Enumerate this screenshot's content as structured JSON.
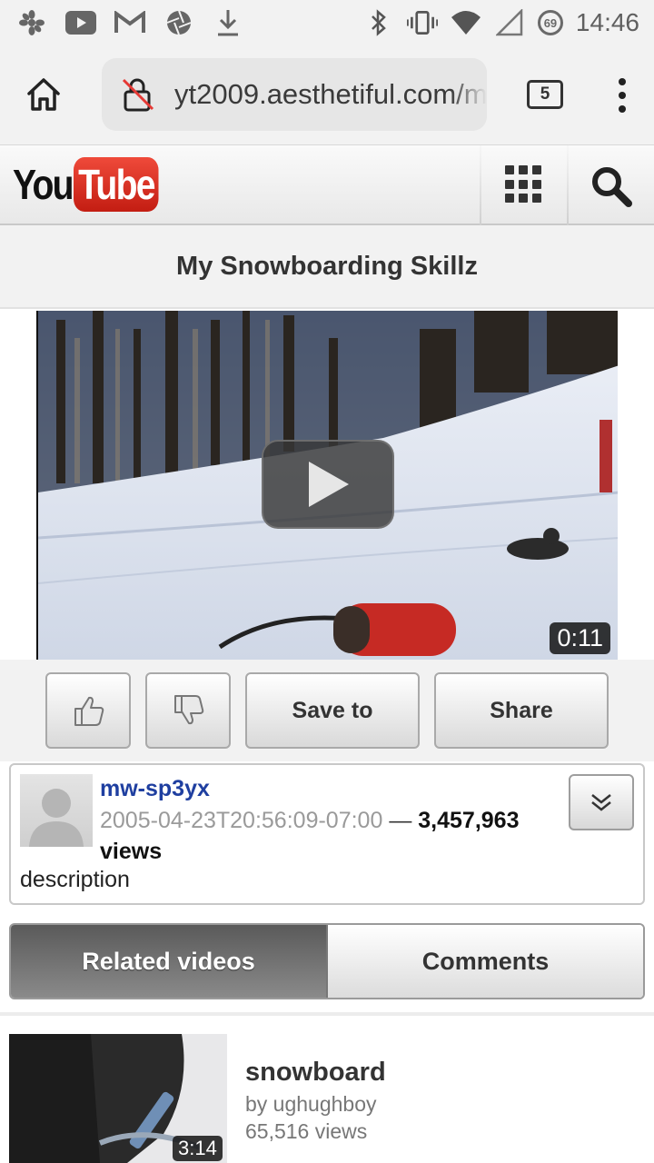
{
  "status_bar": {
    "left_icons": [
      "settings-flower-icon",
      "youtube-icon",
      "gmail-icon",
      "aperture-icon",
      "download-icon"
    ],
    "right_icons": [
      "bluetooth-icon",
      "vibrate-icon",
      "wifi-icon",
      "signal-icon"
    ],
    "battery_level": "69",
    "time": "14:46"
  },
  "browser": {
    "url": "yt2009.aesthetiful.com/m",
    "tab_count": "5"
  },
  "header": {
    "logo_you": "You",
    "logo_tube": "Tube"
  },
  "video": {
    "title": "My Snowboarding Skillz",
    "duration": "0:11"
  },
  "actions": {
    "save_label": "Save to",
    "share_label": "Share"
  },
  "info": {
    "author": "mw-sp3yx",
    "date": "2005-04-23T20:56:09-07:00",
    "separator": "—",
    "views": "3,457,963 views",
    "description": "description"
  },
  "tabs": {
    "related": "Related videos",
    "comments": "Comments"
  },
  "related": [
    {
      "title": "snowboard",
      "by": "by ughughboy",
      "views": "65,516 views",
      "duration": "3:14"
    }
  ],
  "colors": {
    "youtube_red": "#d5281d",
    "author_link": "#1f3fa0"
  }
}
